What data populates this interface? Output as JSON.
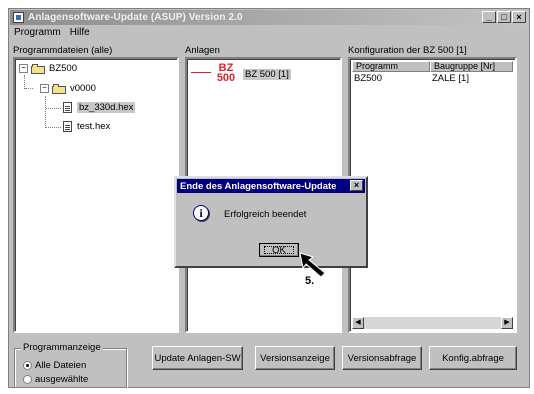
{
  "window": {
    "title": "Anlagensoftware-Update (ASUP) Version 2.0",
    "min_glyph": "_",
    "max_glyph": "□",
    "close_glyph": "×"
  },
  "menu": [
    "Programm",
    "Hilfe"
  ],
  "panels": {
    "program_files_label": "Programmdateien (alle)",
    "systems_label": "Anlagen",
    "config_label": "Konfiguration der BZ 500 [1]"
  },
  "tree": {
    "root": "BZ500",
    "root_expander": "−",
    "child": "v0000",
    "child_expander": "−",
    "files": [
      "bz_330d.hex",
      "test.hex"
    ]
  },
  "systems": {
    "logo_top": "BZ",
    "logo_bottom": "500",
    "entry": "BZ 500 [1]"
  },
  "config": {
    "columns": [
      "Programm",
      "Baugruppe [Nr]"
    ],
    "rows": [
      [
        "BZ500",
        "ZALE [1]"
      ]
    ],
    "scroll_left": "◀",
    "scroll_right": "▶"
  },
  "program_display": {
    "label": "Programmanzeige",
    "options": [
      "Alle Dateien",
      "ausgewählte"
    ],
    "selected": "Alle Dateien"
  },
  "buttons": {
    "update": "Update Anlagen-SW",
    "version_display": "Versionsanzeige",
    "version_query": "Versionsabfrage",
    "config_query": "Konfig.abfrage"
  },
  "dialog": {
    "title": "Ende des Anlagensoftware-Update",
    "close_glyph": "×",
    "info_glyph": "i",
    "message": "Erfolgreich beendet",
    "ok_label": "OK"
  },
  "annotation": {
    "step": "5."
  }
}
